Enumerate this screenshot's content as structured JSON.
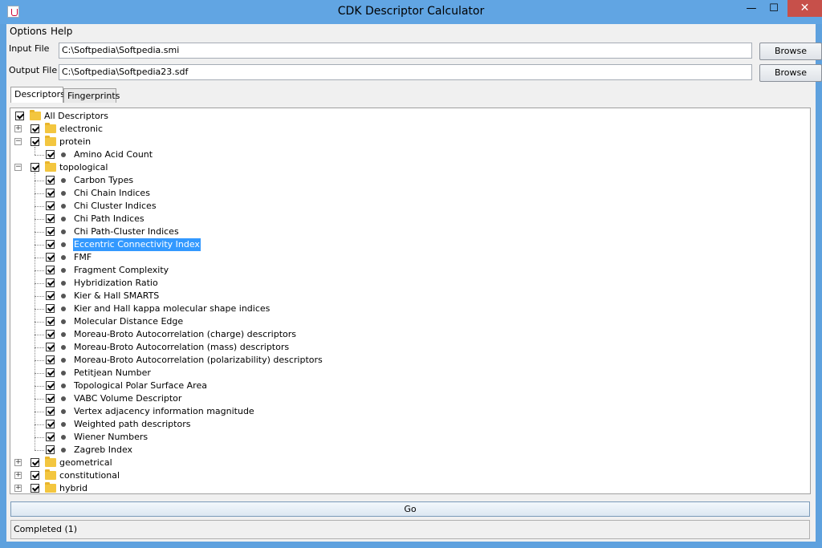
{
  "window": {
    "title": "CDK Descriptor Calculator",
    "minimize": "—",
    "maximize": "☐",
    "close": "✕"
  },
  "menu": [
    "Options",
    "Help"
  ],
  "input_file": {
    "label": "Input File",
    "value": "C:\\Softpedia\\Softpedia.smi",
    "browse": "Browse"
  },
  "output_file": {
    "label": "Output File",
    "value": "C:\\Softpedia\\Softpedia23.sdf",
    "browse": "Browse"
  },
  "tabs": [
    {
      "label": "Descriptors",
      "active": true
    },
    {
      "label": "Fingerprints",
      "active": false
    }
  ],
  "tree": {
    "root": "All Descriptors",
    "items": [
      {
        "label": "electronic",
        "type": "folder",
        "expanded": false
      },
      {
        "label": "protein",
        "type": "folder",
        "expanded": true
      },
      {
        "label": "Amino Acid Count",
        "type": "leaf"
      },
      {
        "label": "topological",
        "type": "folder",
        "expanded": true
      },
      {
        "label": "Carbon Types",
        "type": "leaf"
      },
      {
        "label": "Chi Chain Indices",
        "type": "leaf"
      },
      {
        "label": "Chi Cluster Indices",
        "type": "leaf"
      },
      {
        "label": "Chi Path Indices",
        "type": "leaf"
      },
      {
        "label": "Chi Path-Cluster Indices",
        "type": "leaf"
      },
      {
        "label": "Eccentric Connectivity Index",
        "type": "leaf",
        "selected": true
      },
      {
        "label": "FMF",
        "type": "leaf"
      },
      {
        "label": "Fragment Complexity",
        "type": "leaf"
      },
      {
        "label": "Hybridization Ratio",
        "type": "leaf"
      },
      {
        "label": "Kier & Hall SMARTS",
        "type": "leaf"
      },
      {
        "label": "Kier and Hall kappa molecular shape indices",
        "type": "leaf"
      },
      {
        "label": "Molecular Distance Edge",
        "type": "leaf"
      },
      {
        "label": "Moreau-Broto Autocorrelation (charge) descriptors",
        "type": "leaf"
      },
      {
        "label": "Moreau-Broto Autocorrelation (mass) descriptors",
        "type": "leaf"
      },
      {
        "label": "Moreau-Broto Autocorrelation (polarizability) descriptors",
        "type": "leaf"
      },
      {
        "label": "Petitjean Number",
        "type": "leaf"
      },
      {
        "label": "Topological Polar Surface Area",
        "type": "leaf"
      },
      {
        "label": "VABC Volume Descriptor",
        "type": "leaf"
      },
      {
        "label": "Vertex adjacency information magnitude",
        "type": "leaf"
      },
      {
        "label": "Weighted path descriptors",
        "type": "leaf"
      },
      {
        "label": "Wiener Numbers",
        "type": "leaf"
      },
      {
        "label": "Zagreb Index",
        "type": "leaf"
      },
      {
        "label": "geometrical",
        "type": "folder",
        "expanded": false
      },
      {
        "label": "constitutional",
        "type": "folder",
        "expanded": false
      },
      {
        "label": "hybrid",
        "type": "folder",
        "expanded": false
      }
    ]
  },
  "go_label": "Go",
  "status": "Completed (1)",
  "colors": {
    "selection": "#3399ff",
    "titlebar": "#61a5e3",
    "close": "#c7504a",
    "folder": "#f3c63f"
  }
}
